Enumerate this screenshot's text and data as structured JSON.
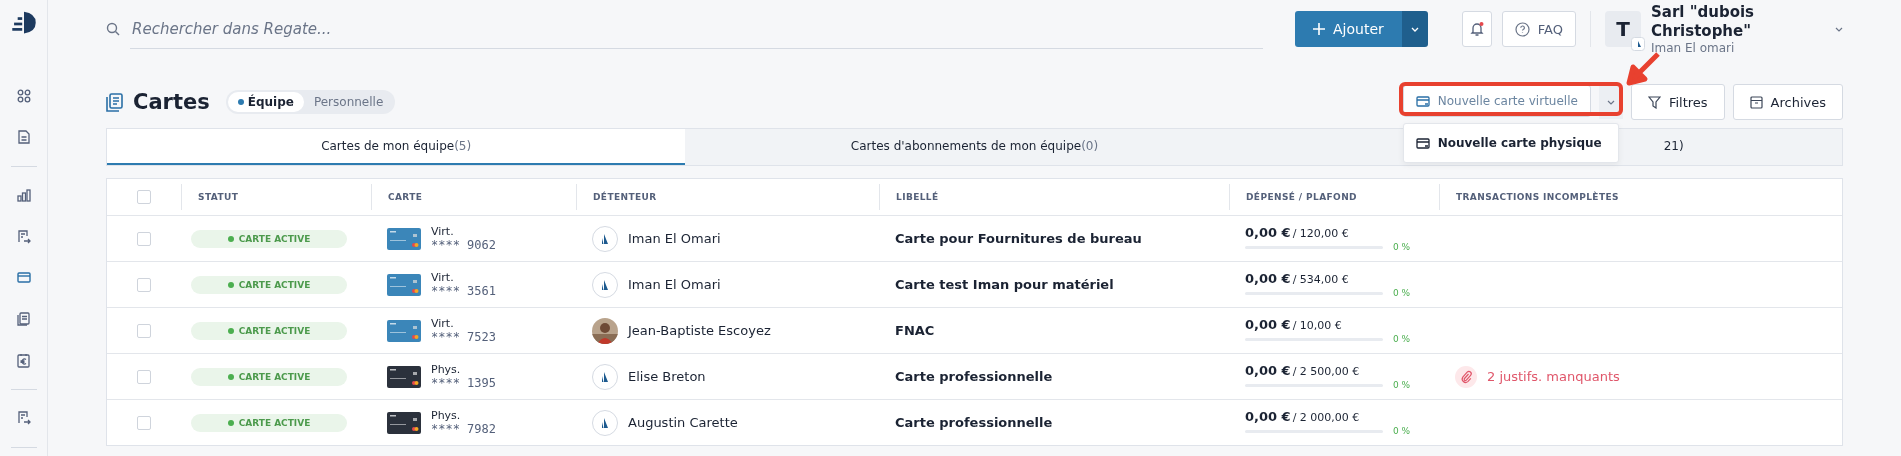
{
  "search": {
    "placeholder": "Rechercher dans Regate..."
  },
  "topbar": {
    "add_button": "Ajouter",
    "notification_unread": true,
    "faq": "FAQ",
    "avatar_letter": "T",
    "org_name": "Sarl \"dubois Christophe\"",
    "user_name": "Iman El omari"
  },
  "sidebar": {
    "items": [
      {
        "kind": "apps",
        "selected": false
      },
      {
        "kind": "document",
        "selected": false
      },
      {
        "kind": "divider"
      },
      {
        "kind": "chart",
        "selected": false
      },
      {
        "kind": "transfer",
        "selected": false
      },
      {
        "kind": "card",
        "selected": true
      },
      {
        "kind": "stack",
        "selected": false
      },
      {
        "kind": "euro",
        "selected": false
      },
      {
        "kind": "divider"
      },
      {
        "kind": "transfer",
        "selected": false
      },
      {
        "kind": "divider"
      }
    ]
  },
  "page": {
    "title": "Cartes",
    "scope": [
      {
        "label": "Équipe",
        "selected": true
      },
      {
        "label": "Personnelle",
        "selected": false
      }
    ]
  },
  "actions": {
    "new_virtual": "Nouvelle carte virtuelle",
    "filters": "Filtres",
    "archives": "Archives",
    "menu": [
      {
        "label": "Nouvelle carte physique"
      }
    ]
  },
  "tabs": [
    {
      "label": "Cartes de mon équipe",
      "count": "(5)",
      "selected": true
    },
    {
      "label": "Cartes d'abonnements de mon équipe",
      "count": "(0)",
      "selected": false
    },
    {
      "label": "21)",
      "selected": false
    }
  ],
  "table": {
    "all_checked": false,
    "columns": [
      "STATUT",
      "CARTE",
      "DÉTENTEUR",
      "LIBELLÉ",
      "DÉPENSÉ / PLAFOND",
      "TRANSACTIONS INCOMPLÈTES"
    ],
    "rows": [
      {
        "checked": false,
        "status": "CARTE ACTIVE",
        "card": {
          "kind": "virtual",
          "label": "Virt.",
          "number": "**** 9062"
        },
        "holder": {
          "kind": "logo",
          "name": "Iman El Omari"
        },
        "label": "Carte pour Fournitures de bureau",
        "spent": "0,00 €",
        "limit": "/ 120,00 €",
        "level": 0,
        "percent": "0 %"
      },
      {
        "checked": false,
        "status": "CARTE ACTIVE",
        "card": {
          "kind": "virtual",
          "label": "Virt.",
          "number": "**** 3561"
        },
        "holder": {
          "kind": "logo",
          "name": "Iman El Omari"
        },
        "label": "Carte test Iman pour matériel",
        "spent": "0,00 €",
        "limit": "/ 534,00 €",
        "level": 0,
        "percent": "0 %"
      },
      {
        "checked": false,
        "status": "CARTE ACTIVE",
        "card": {
          "kind": "virtual",
          "label": "Virt.",
          "number": "**** 7523"
        },
        "holder": {
          "kind": "picture",
          "name": "Jean-Baptiste Escoyez"
        },
        "label": "FNAC",
        "spent": "0,00 €",
        "limit": "/ 10,00 €",
        "level": 0,
        "percent": "0 %"
      },
      {
        "checked": false,
        "status": "CARTE ACTIVE",
        "card": {
          "kind": "physical",
          "label": "Phys.",
          "number": "**** 1395"
        },
        "holder": {
          "kind": "logo",
          "name": "Elise Breton"
        },
        "label": "Carte professionnelle",
        "spent": "0,00 €",
        "limit": "/ 2 500,00 €",
        "level": 0,
        "percent": "0 %",
        "missing": "2 justifs. manquants"
      },
      {
        "checked": false,
        "status": "CARTE ACTIVE",
        "card": {
          "kind": "physical",
          "label": "Phys.",
          "number": "**** 7982"
        },
        "holder": {
          "kind": "logo",
          "name": "Augustin Carette"
        },
        "label": "Carte professionnelle",
        "spent": "0,00 €",
        "limit": "/ 2 000,00 €",
        "level": 0,
        "percent": "0 %"
      }
    ]
  }
}
